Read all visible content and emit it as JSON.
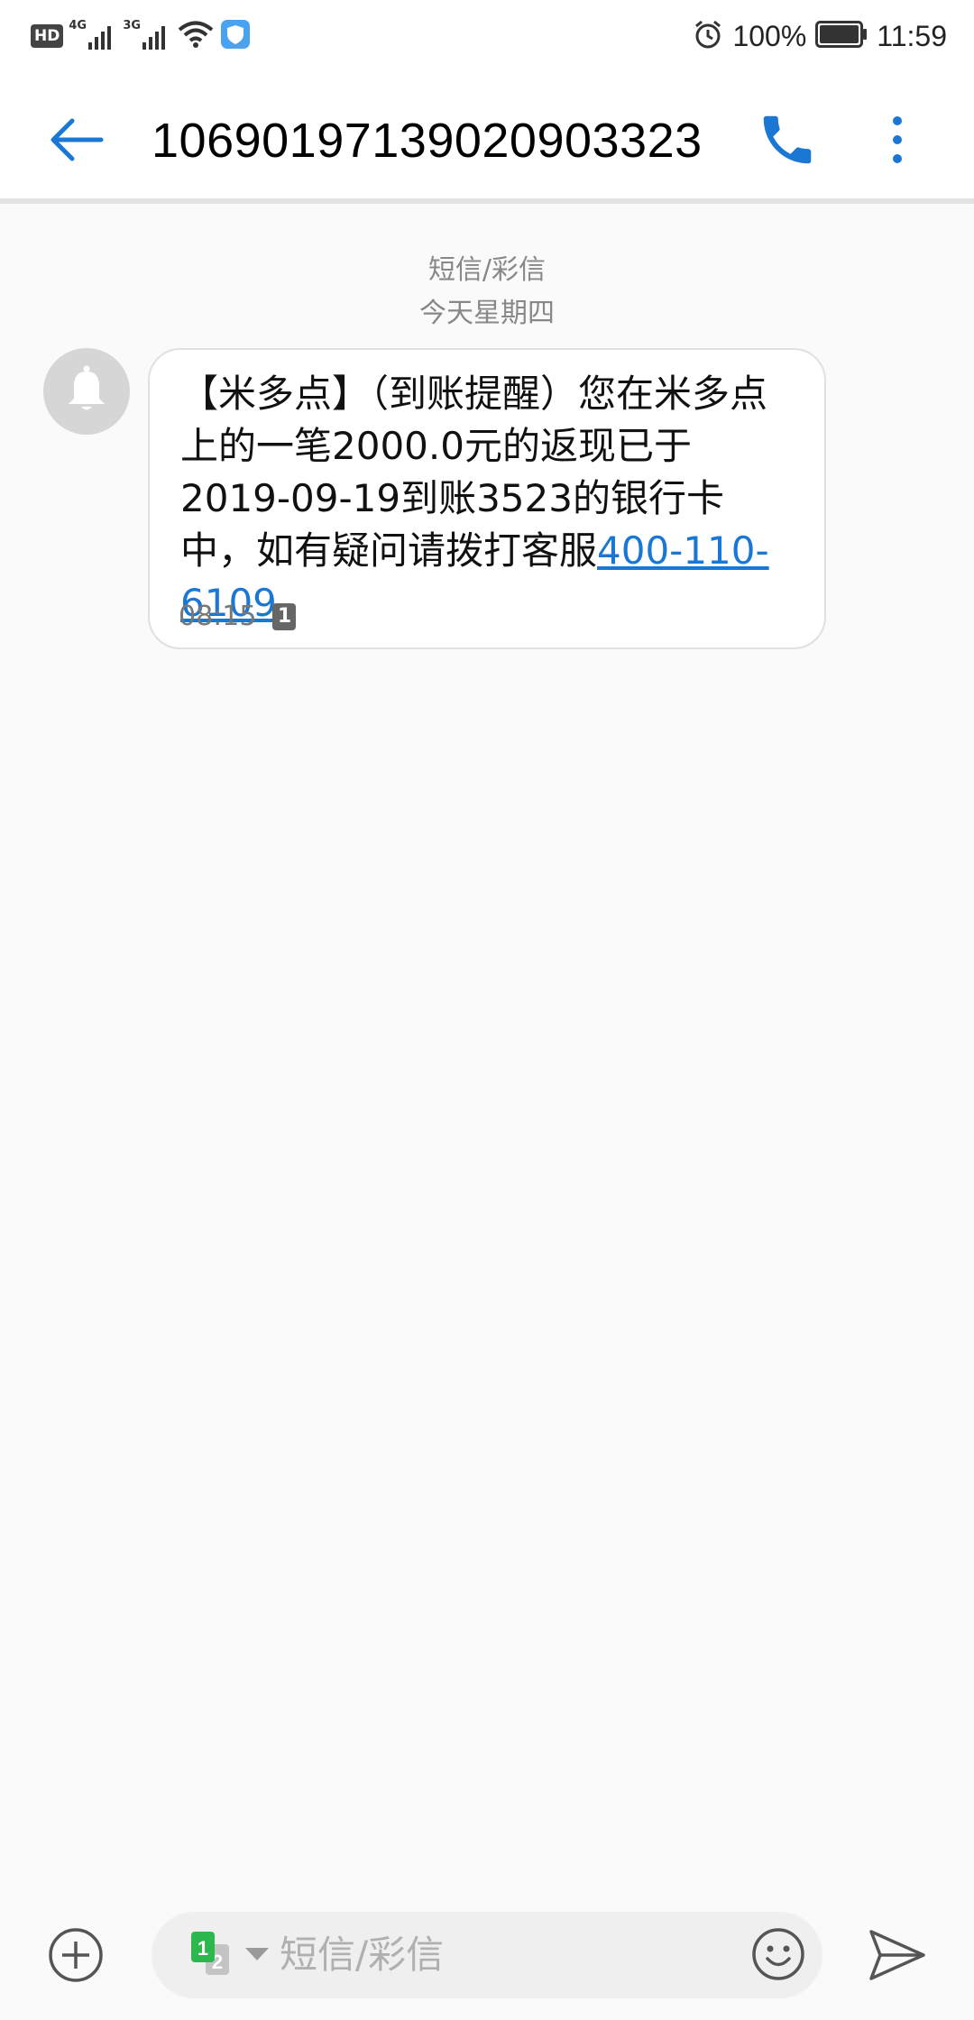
{
  "status_bar": {
    "hd": "HD",
    "net1": "4G",
    "net2": "3G",
    "battery_percent": "100%",
    "battery_level": 1.0,
    "time": "11:59"
  },
  "app_bar": {
    "title": "10690197139020903323"
  },
  "conversation": {
    "header_type": "短信/彩信",
    "header_date": "今天星期四",
    "message": {
      "body": "【米多点】（到账提醒）您在米多点上的一笔2000.0元的返现已于2019-09-19到账3523的银行卡中，如有疑问请拨打客服",
      "link": "400-110-6109",
      "time": "08:15",
      "sim": "1"
    }
  },
  "compose": {
    "placeholder": "短信/彩信",
    "sim1": "1",
    "sim2": "2"
  },
  "colors": {
    "accent": "#1a78d4",
    "background": "#fafafa",
    "sim_green": "#2db84d"
  }
}
